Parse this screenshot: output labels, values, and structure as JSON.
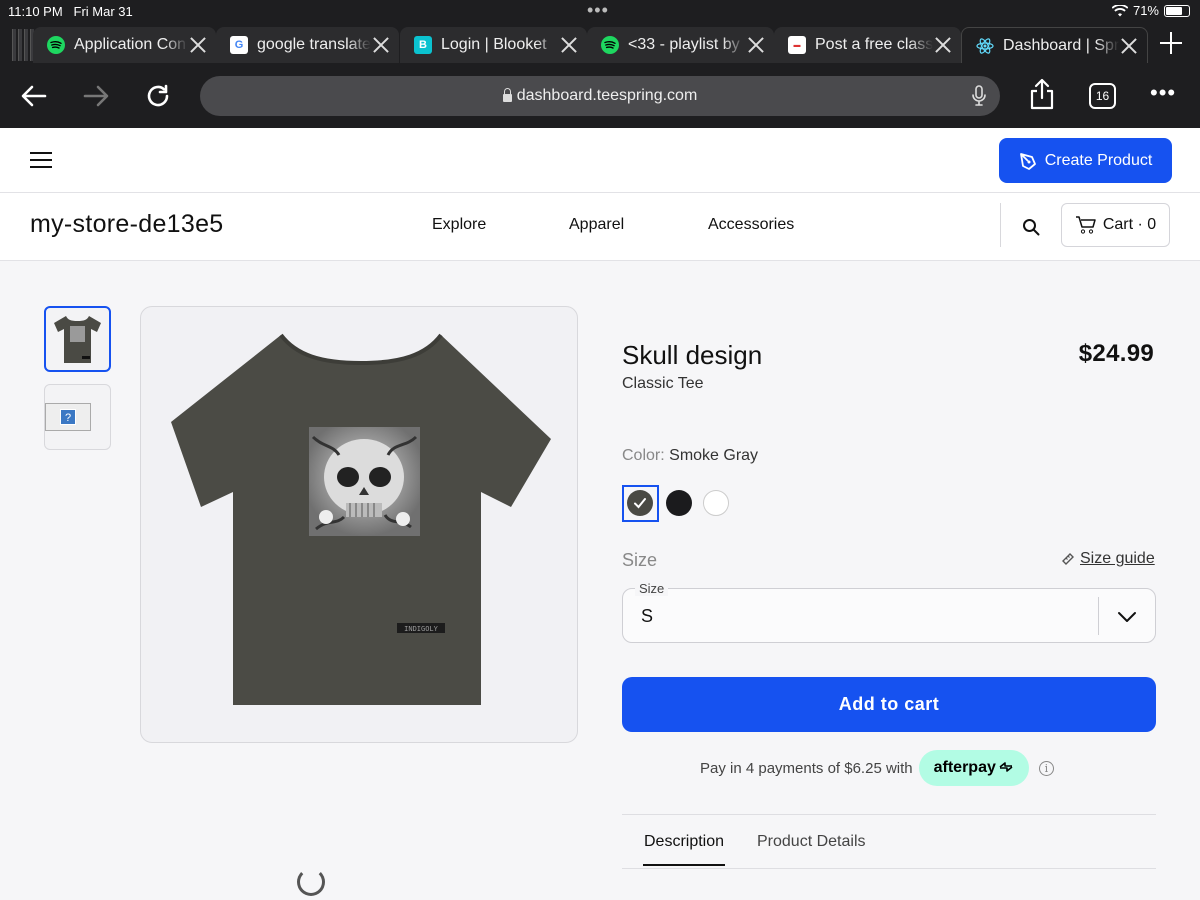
{
  "status_bar": {
    "time": "11:10 PM",
    "date": "Fri Mar 31",
    "battery": "71%"
  },
  "tabs": [
    {
      "title": "Application Con",
      "icon": "spotify-icon",
      "active": false
    },
    {
      "title": "google translate",
      "icon": "google-icon",
      "active": false
    },
    {
      "title": "Login | Blooket",
      "icon": "blooket-icon",
      "active": false
    },
    {
      "title": "<33 - playlist by",
      "icon": "spotify-icon",
      "active": false
    },
    {
      "title": "Post a free class",
      "icon": "site-icon",
      "active": false
    },
    {
      "title": "Dashboard | Spring",
      "icon": "react-icon",
      "active": true
    }
  ],
  "browser": {
    "url": "dashboard.teespring.com",
    "tab_count": "16"
  },
  "header": {
    "create_button": "Create Product"
  },
  "store": {
    "name": "my-store-de13e5",
    "nav": [
      "Explore",
      "Apparel",
      "Accessories"
    ],
    "cart": "Cart · 0"
  },
  "product": {
    "title": "Skull design",
    "subtitle": "Classic Tee",
    "price": "$24.99",
    "color_label": "Color:",
    "color_value": "Smoke Gray",
    "colors": [
      "#4a4a44",
      "#1b1b1d",
      "#ffffff"
    ],
    "size_heading": "Size",
    "size_guide": "Size guide",
    "size_field_label": "Size",
    "size_value": "S",
    "add_to_cart": "Add to cart",
    "afterpay_text": "Pay in 4 payments of $6.25 with",
    "afterpay_brand": "afterpay",
    "shirt_tag": "INDIGOLY",
    "tabs": [
      "Description",
      "Product Details"
    ]
  },
  "colors": {
    "accent": "#1652f0",
    "afterpay": "#b2fce4",
    "chrome": "#1e1e20"
  }
}
